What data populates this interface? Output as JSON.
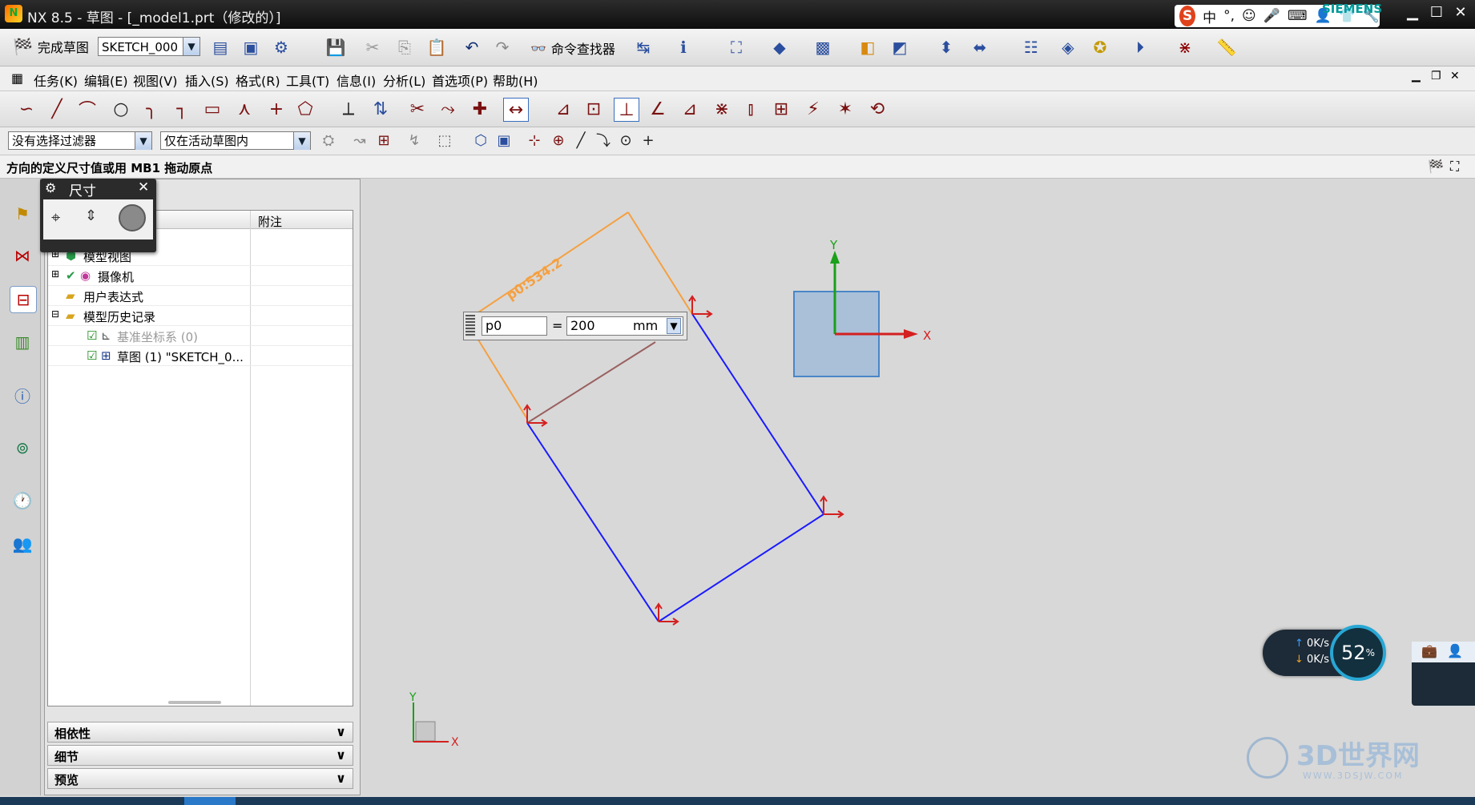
{
  "window": {
    "title": "NX 8.5 - 草图 - [_model1.prt（修改的）]",
    "brand": "SIEMENS"
  },
  "ime": {
    "lang": "中",
    "punct": "°,"
  },
  "toolbar1": {
    "finish_sketch": "完成草图",
    "sketch_name": "SKETCH_000",
    "command_finder": "命令查找器"
  },
  "menu": {
    "items": [
      "任务(K)",
      "编辑(E)",
      "视图(V)",
      "插入(S)",
      "格式(R)",
      "工具(T)",
      "信息(I)",
      "分析(L)",
      "首选项(P)",
      "帮助(H)"
    ]
  },
  "selection": {
    "filter": "没有选择过滤器",
    "scope": "仅在活动草图内"
  },
  "status": {
    "message": "方向的定义尺寸值或用 MB1 拖动原点"
  },
  "dimension_dialog": {
    "title": "尺寸"
  },
  "navigator": {
    "col_note": "附注",
    "rows": [
      {
        "label": "模型视图"
      },
      {
        "label": "摄像机"
      },
      {
        "label": "用户表达式"
      },
      {
        "label": "模型历史记录"
      },
      {
        "label": "基准坐标系 (0)"
      },
      {
        "label": "草图 (1) \"SKETCH_0..."
      }
    ],
    "sections": [
      "相依性",
      "细节",
      "预览"
    ]
  },
  "dimension_input": {
    "name": "p0",
    "equals": "=",
    "value": "200",
    "unit": "mm"
  },
  "canvas": {
    "dim_label": "p0:534.2",
    "axis_x": "X",
    "axis_y": "Y",
    "small_axis_x": "X",
    "small_axis_y": "Y"
  },
  "network_widget": {
    "up": "0K/s",
    "down": "0K/s",
    "percent": "52",
    "percent_sign": "%"
  },
  "watermark": {
    "text": "3D世界网",
    "url": "WWW.3DSJW.COM"
  },
  "colors": {
    "sketch_line": "#1a1aff",
    "dimension": "#f5a040",
    "constraint": "#d42020",
    "brand": "#009999",
    "datum_plane": "#a9c0d8"
  }
}
